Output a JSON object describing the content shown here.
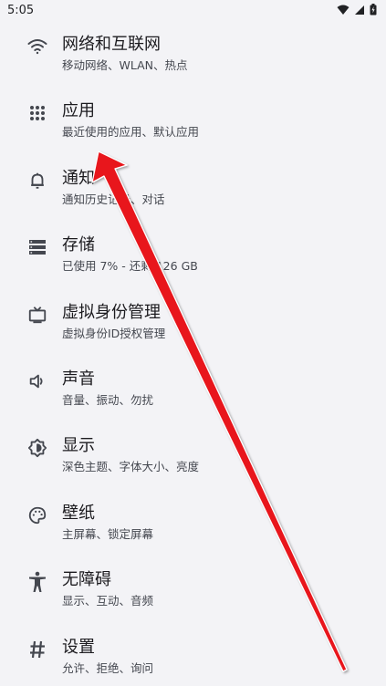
{
  "status_bar": {
    "time": "5:05",
    "icons": [
      "wifi-icon",
      "cellular-signal-icon",
      "battery-icon"
    ]
  },
  "settings": [
    {
      "key": "network",
      "title": "网络和互联网",
      "subtitle": "移动网络、WLAN、热点",
      "icon": "wifi-icon"
    },
    {
      "key": "apps",
      "title": "应用",
      "subtitle": "最近使用的应用、默认应用",
      "icon": "apps-grid-icon"
    },
    {
      "key": "notifications",
      "title": "通知",
      "subtitle": "通知历史记录、对话",
      "icon": "bell-icon"
    },
    {
      "key": "storage",
      "title": "存储",
      "subtitle": "已使用 7% - 还剩 126 GB",
      "icon": "storage-icon"
    },
    {
      "key": "virtual-identity",
      "title": "虚拟身份管理",
      "subtitle": "虚拟身份ID授权管理",
      "icon": "tv-icon"
    },
    {
      "key": "sound",
      "title": "声音",
      "subtitle": "音量、振动、勿扰",
      "icon": "speaker-icon"
    },
    {
      "key": "display",
      "title": "显示",
      "subtitle": "深色主题、字体大小、亮度",
      "icon": "brightness-icon"
    },
    {
      "key": "wallpaper",
      "title": "壁纸",
      "subtitle": "主屏幕、锁定屏幕",
      "icon": "palette-icon"
    },
    {
      "key": "accessibility",
      "title": "无障碍",
      "subtitle": "显示、互动、音频",
      "icon": "accessibility-icon"
    },
    {
      "key": "settings",
      "title": "设置",
      "subtitle": "允许、拒绝、询问",
      "icon": "hash-icon"
    }
  ],
  "overlay": {
    "arrow_color": "#e8141c"
  }
}
